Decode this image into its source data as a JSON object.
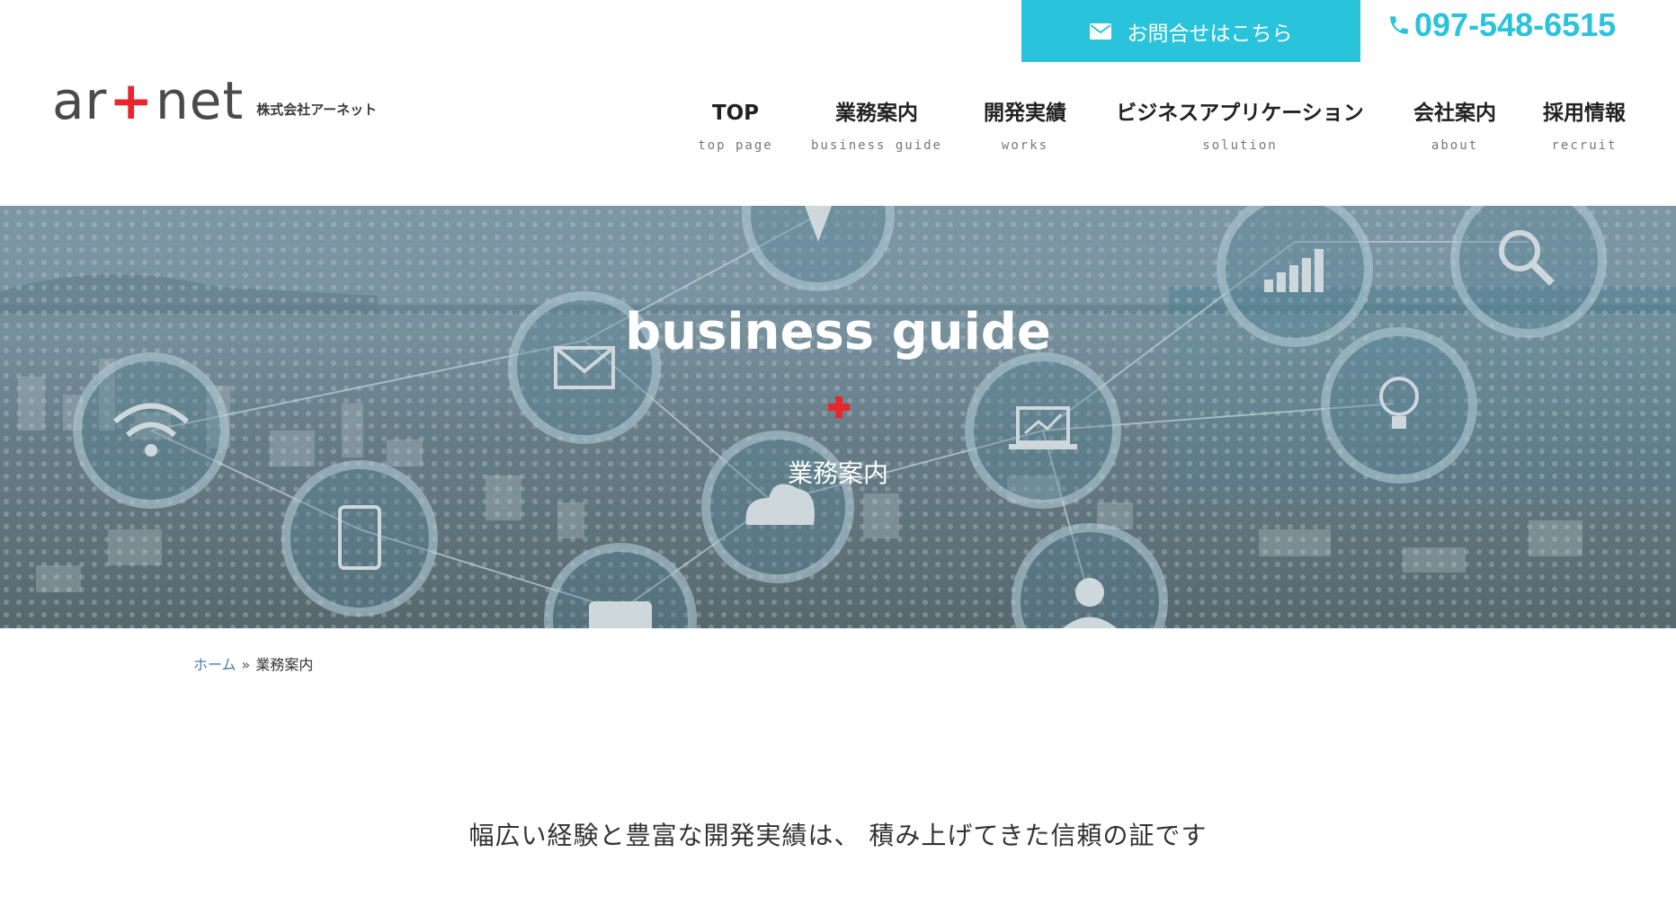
{
  "header": {
    "contact_label": "お問合せはこちら",
    "phone": "097-548-6515",
    "logo": {
      "text_left": "ar",
      "text_plus": "+",
      "text_right": "net",
      "company": "株式会社アーネット"
    },
    "nav": [
      {
        "jp": "TOP",
        "en": "top page"
      },
      {
        "jp": "業務案内",
        "en": "business guide"
      },
      {
        "jp": "開発実績",
        "en": "works"
      },
      {
        "jp": "ビジネスアプリケーション",
        "en": "solution"
      },
      {
        "jp": "会社案内",
        "en": "about"
      },
      {
        "jp": "採用情報",
        "en": "recruit"
      }
    ]
  },
  "hero": {
    "title": "business guide",
    "subtitle": "業務案内",
    "icons": [
      "location-pin-icon",
      "mail-icon",
      "wifi-icon",
      "tablet-icon",
      "cloud-icon",
      "chat-icon",
      "laptop-chart-icon",
      "person-icon",
      "bar-chart-icon",
      "magnifier-icon",
      "lightbulb-icon"
    ]
  },
  "breadcrumb": {
    "home": "ホーム",
    "separator": "»",
    "current": "業務案内"
  },
  "lead": "幅広い経験と豊富な開発実績は、 積み上げてきた信頼の証です",
  "colors": {
    "accent": "#29c3dc",
    "brand_red": "#e8262b"
  }
}
